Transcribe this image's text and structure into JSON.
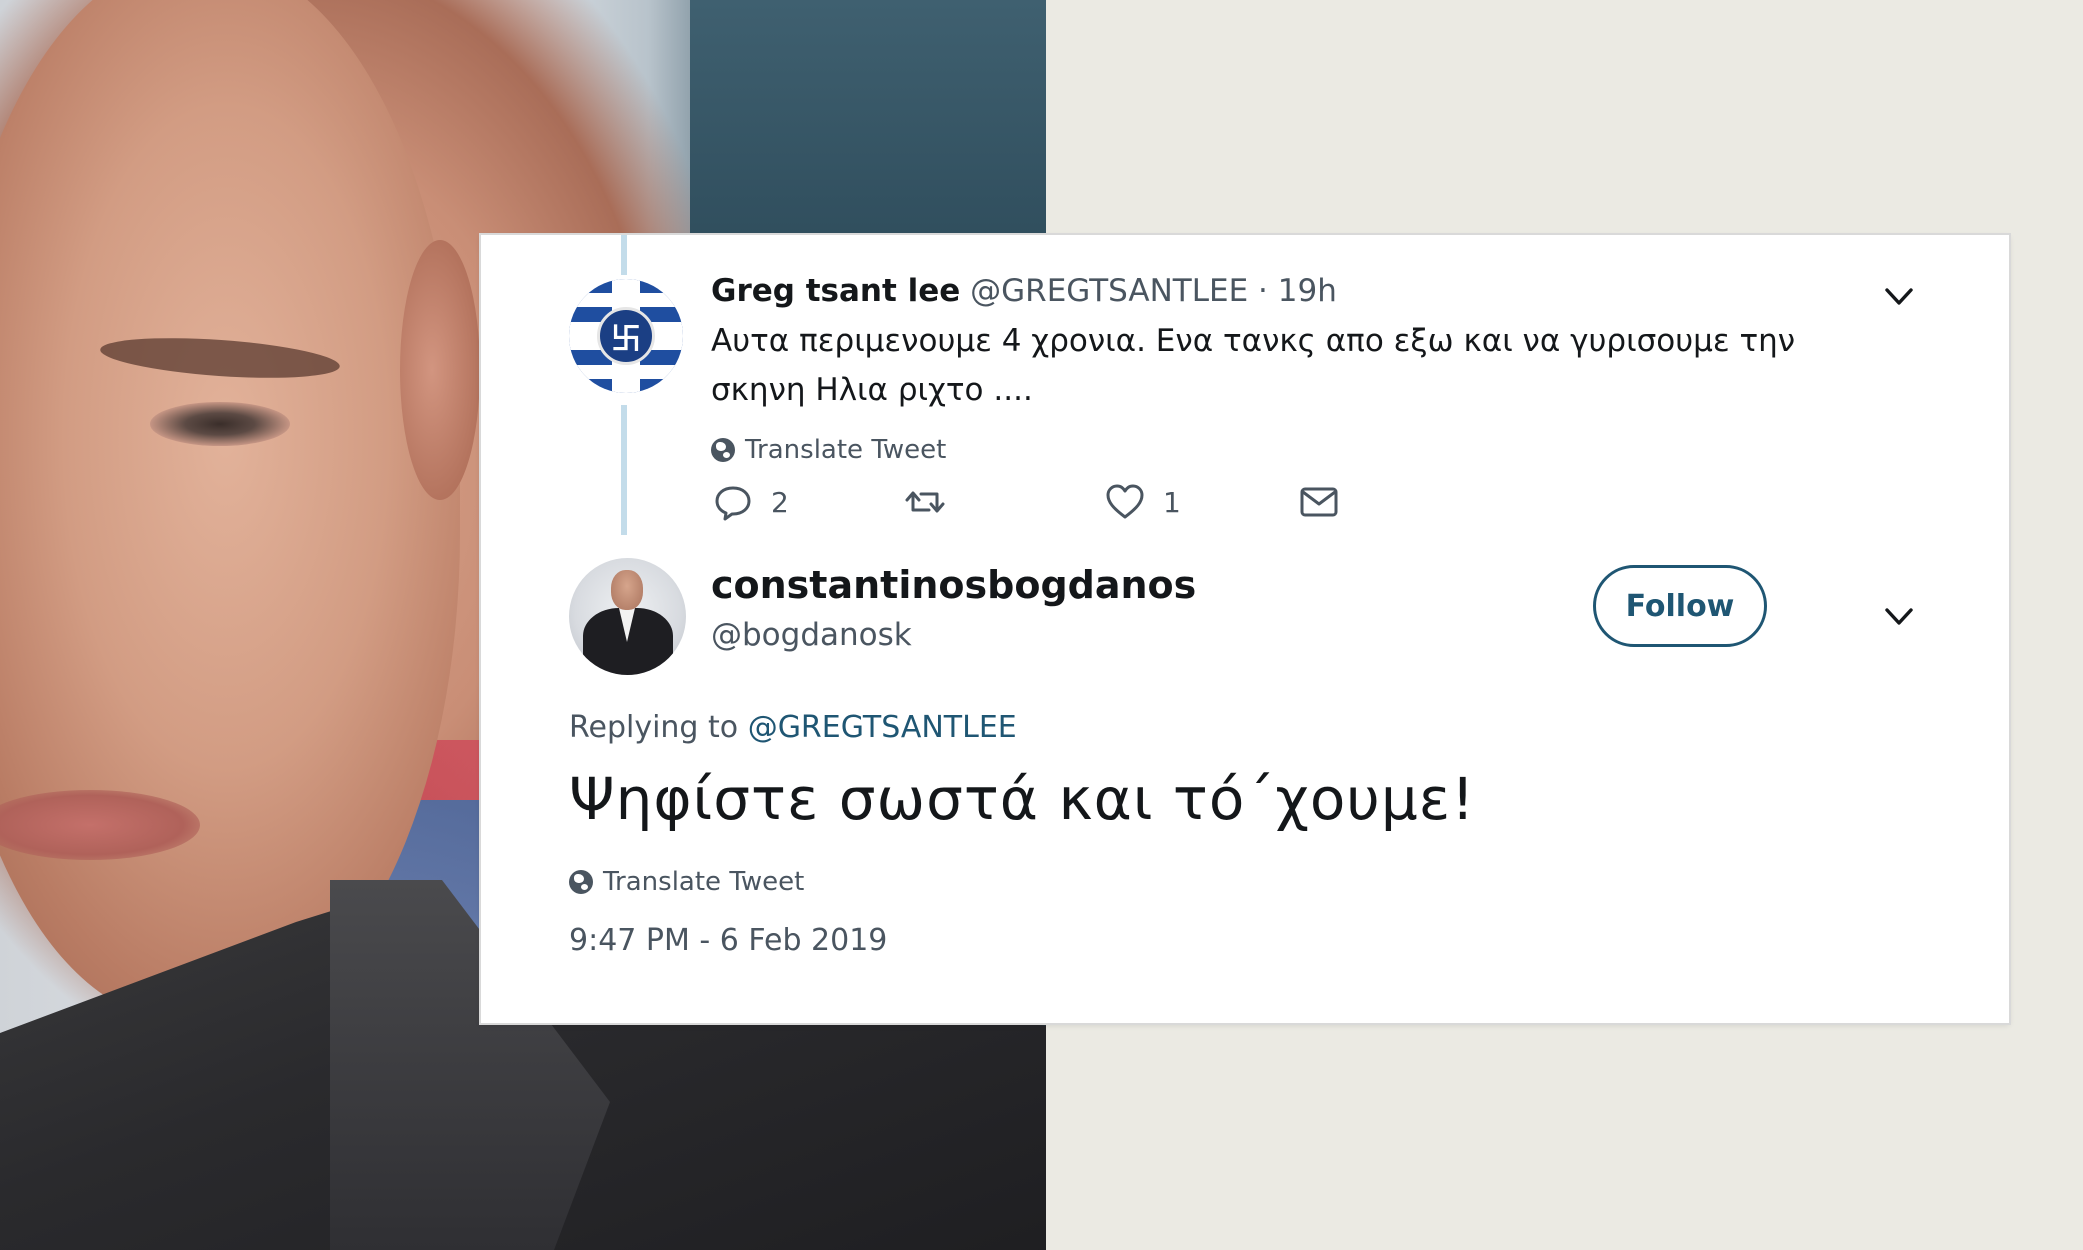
{
  "colors": {
    "page_background": "#ebeae3",
    "card_background": "#ffffff",
    "text_primary": "#14171a",
    "text_secondary": "#4a5560",
    "link_accent": "#1f5673",
    "thread_line": "#c3dcea"
  },
  "photo": {
    "description_icon": "portrait-photo"
  },
  "parent_tweet": {
    "author_name": "Greg tsant lee",
    "author_handle": "@GREGTSANTLEE",
    "separator": "·",
    "time_ago": "19h",
    "text": "Αυτα περιμενουμε 4 χρονια. Ενα τανκς απο εξω και να γυρισουμε την σκηνη Ηλια ριχτο ....",
    "translate_label": "Translate Tweet",
    "actions": {
      "reply_count": "2",
      "retweet_count": "",
      "like_count": "1",
      "reply_icon": "reply-icon",
      "retweet_icon": "retweet-icon",
      "like_icon": "heart-icon",
      "message_icon": "envelope-icon"
    }
  },
  "reply_tweet": {
    "author_name": "constantinosbogdanos",
    "author_handle": "@bogdanosk",
    "follow_label": "Follow",
    "replying_to_prefix": "Replying to",
    "replying_to_handle": "@GREGTSANTLEE",
    "text": "Ψηφίστε σωστά και τό΄χουμε!",
    "translate_label": "Translate Tweet",
    "timestamp": "9:47 PM - 6 Feb 2019"
  }
}
